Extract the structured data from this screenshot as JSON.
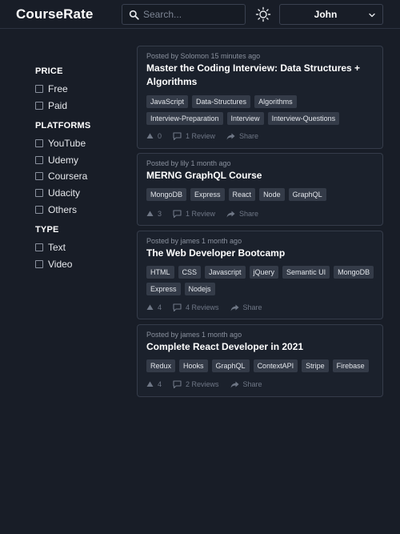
{
  "header": {
    "logo": "CourseRate",
    "search_placeholder": "Search...",
    "user_name": "John"
  },
  "filters": {
    "price": {
      "title": "PRICE",
      "options": [
        "Free",
        "Paid"
      ]
    },
    "platforms": {
      "title": "PLATFORMS",
      "options": [
        "YouTube",
        "Udemy",
        "Coursera",
        "Udacity",
        "Others"
      ]
    },
    "type": {
      "title": "TYPE",
      "options": [
        "Text",
        "Video"
      ]
    }
  },
  "posts": [
    {
      "posted": "Posted by Solomon 15 minutes ago",
      "title": "Master the Coding Interview: Data Structures + Algorithms",
      "tags": [
        "JavaScript",
        "Data-Structures",
        "Algorithms",
        "Interview-Preparation",
        "Interview",
        "Interview-Questions"
      ],
      "votes": "0",
      "reviews": "1 Review",
      "share": "Share"
    },
    {
      "posted": "Posted by lily 1 month ago",
      "title": "MERNG GraphQL Course",
      "tags": [
        "MongoDB",
        "Express",
        "React",
        "Node",
        "GraphQL"
      ],
      "votes": "3",
      "reviews": "1 Review",
      "share": "Share"
    },
    {
      "posted": "Posted by james 1 month ago",
      "title": "The Web Developer Bootcamp",
      "tags": [
        "HTML",
        "CSS",
        "Javascript",
        "jQuery",
        "Semantic UI",
        "MongoDB",
        "Express",
        "Nodejs"
      ],
      "votes": "4",
      "reviews": "4 Reviews",
      "share": "Share"
    },
    {
      "posted": "Posted by james 1 month ago",
      "title": "Complete React Developer in 2021",
      "tags": [
        "Redux",
        "Hooks",
        "GraphQL",
        "ContextAPI",
        "Stripe",
        "Firebase"
      ],
      "votes": "4",
      "reviews": "2 Reviews",
      "share": "Share"
    }
  ]
}
